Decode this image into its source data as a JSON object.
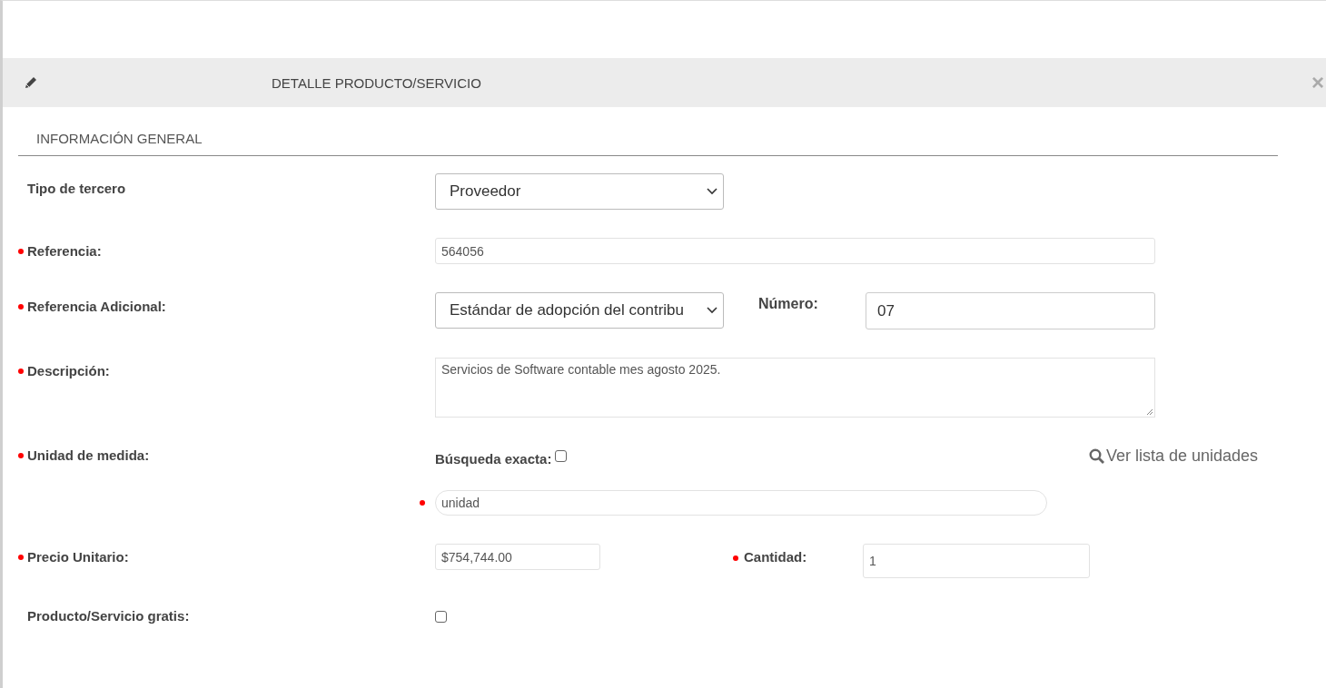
{
  "dialog": {
    "title": "DETALLE PRODUCTO/SERVICIO",
    "close": "×"
  },
  "section": {
    "title": "INFORMACIÓN GENERAL"
  },
  "rows": [
    {
      "kind": "select",
      "label": "Tipo de tercero",
      "required": false,
      "value": "Proveedor"
    },
    {
      "kind": "text",
      "label": "Referencia:",
      "required": true,
      "value": "564056"
    },
    {
      "kind": "select_number",
      "label": "Referencia Adicional:",
      "required": true,
      "value": "Estándar de adopción del contribu",
      "number_label": "Número:",
      "number_value": "07"
    },
    {
      "kind": "textarea",
      "label": "Descripción:",
      "required": true,
      "value": "Servicios de Software contable mes agosto 2025."
    },
    {
      "kind": "unit",
      "label": "Unidad de medida:",
      "required": true,
      "exact_label": "Búsqueda exacta:",
      "exact_checked": false,
      "link": "Ver lista de unidades",
      "value": "unidad",
      "value_required": true
    },
    {
      "kind": "price",
      "label": "Precio Unitario:",
      "required": true,
      "value": "$754,744.00",
      "quantity_label": "Cantidad:",
      "quantity_required": true,
      "quantity_value": "1"
    },
    {
      "kind": "checkbox",
      "label": "Producto/Servicio gratis:",
      "required": false,
      "checked": false
    }
  ]
}
